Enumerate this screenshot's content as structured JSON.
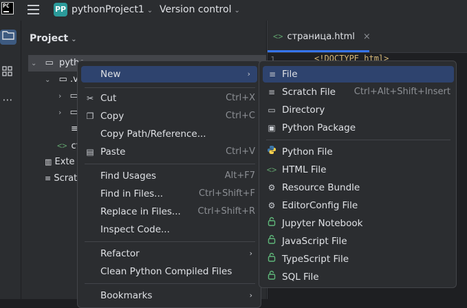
{
  "titlebar": {
    "logo": "PC",
    "project_badge": "PP",
    "project_name": "pythonProject1",
    "vcs_label": "Version control"
  },
  "project_panel": {
    "title": "Project",
    "rows": [
      "pytho",
      ".v",
      "ст",
      "Exte",
      "Scrat"
    ]
  },
  "editor": {
    "tab_label": "страница.html",
    "line_number": "1",
    "code_line": "<!DOCTYPE html>"
  },
  "context_menu": {
    "items": [
      {
        "label": "New",
        "shortcut": "",
        "submenu": true
      },
      {
        "label": "Cut",
        "shortcut": "Ctrl+X"
      },
      {
        "label": "Copy",
        "shortcut": "Ctrl+C"
      },
      {
        "label": "Copy Path/Reference...",
        "shortcut": ""
      },
      {
        "label": "Paste",
        "shortcut": "Ctrl+V"
      },
      {
        "label": "Find Usages",
        "shortcut": "Alt+F7"
      },
      {
        "label": "Find in Files...",
        "shortcut": "Ctrl+Shift+F"
      },
      {
        "label": "Replace in Files...",
        "shortcut": "Ctrl+Shift+R"
      },
      {
        "label": "Inspect Code...",
        "shortcut": ""
      },
      {
        "label": "Refactor",
        "shortcut": "",
        "submenu": true
      },
      {
        "label": "Clean Python Compiled Files",
        "shortcut": ""
      },
      {
        "label": "Bookmarks",
        "shortcut": "",
        "submenu": true
      }
    ]
  },
  "new_submenu": {
    "items": [
      {
        "label": "File",
        "shortcut": "",
        "icon": "file-lines-icon"
      },
      {
        "label": "Scratch File",
        "shortcut": "Ctrl+Alt+Shift+Insert",
        "icon": "scratch-file-icon"
      },
      {
        "label": "Directory",
        "shortcut": "",
        "icon": "folder-icon"
      },
      {
        "label": "Python Package",
        "shortcut": "",
        "icon": "package-folder-icon"
      },
      {
        "label": "Python File",
        "shortcut": "",
        "icon": "python-icon"
      },
      {
        "label": "HTML File",
        "shortcut": "",
        "icon": "html-tag-icon"
      },
      {
        "label": "Resource Bundle",
        "shortcut": "",
        "icon": "gear-icon"
      },
      {
        "label": "EditorConfig File",
        "shortcut": "",
        "icon": "gear-icon"
      },
      {
        "label": "Jupyter Notebook",
        "shortcut": "",
        "icon": "lock-icon"
      },
      {
        "label": "JavaScript File",
        "shortcut": "",
        "icon": "lock-icon"
      },
      {
        "label": "TypeScript File",
        "shortcut": "",
        "icon": "lock-icon"
      },
      {
        "label": "SQL File",
        "shortcut": "",
        "icon": "lock-icon"
      }
    ]
  }
}
